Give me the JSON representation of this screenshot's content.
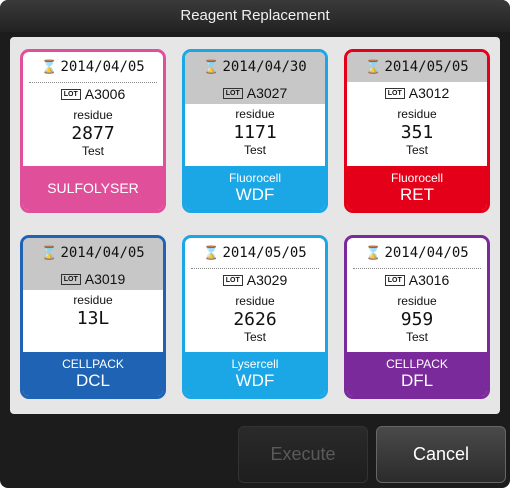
{
  "dialog": {
    "title": "Reagent Replacement"
  },
  "cards": [
    {
      "date": "2014/04/05",
      "lot": "A3006",
      "residue_label": "residue",
      "residue": "2877",
      "unit": "Test",
      "footer_line1": "",
      "footer_line2": "SULFOLYSER",
      "color": "#e0509a"
    },
    {
      "date": "2014/04/30",
      "lot": "A3027",
      "residue_label": "residue",
      "residue": "1171",
      "unit": "Test",
      "footer_line1": "Fluorocell",
      "footer_line2": "WDF",
      "color": "#1ba6e6"
    },
    {
      "date": "2014/05/05",
      "lot": "A3012",
      "residue_label": "residue",
      "residue": "351",
      "unit": "Test",
      "footer_line1": "Fluorocell",
      "footer_line2": "RET",
      "color": "#e5001a"
    },
    {
      "date": "2014/04/05",
      "lot": "A3019",
      "residue_label": "residue",
      "residue": "13L",
      "unit": "",
      "footer_line1": "CELLPACK",
      "footer_line2": "DCL",
      "color": "#1e63b4"
    },
    {
      "date": "2014/05/05",
      "lot": "A3029",
      "residue_label": "residue",
      "residue": "2626",
      "unit": "Test",
      "footer_line1": "Lysercell",
      "footer_line2": "WDF",
      "color": "#1ba6e6"
    },
    {
      "date": "2014/04/05",
      "lot": "A3016",
      "residue_label": "residue",
      "residue": "959",
      "unit": "Test",
      "footer_line1": "CELLPACK",
      "footer_line2": "DFL",
      "color": "#7b2a9c"
    }
  ],
  "lot_badge": "LOT",
  "buttons": {
    "execute": "Execute",
    "cancel": "Cancel"
  }
}
